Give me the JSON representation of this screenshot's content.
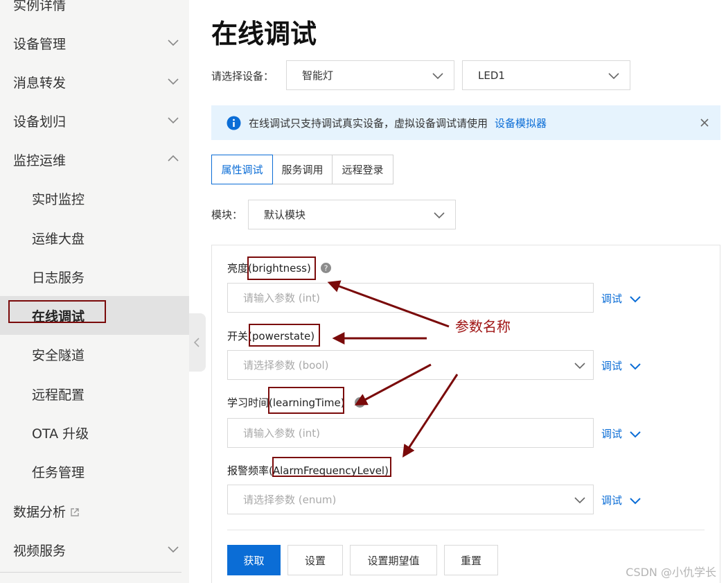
{
  "sidebar": {
    "items": [
      {
        "label": "实例详情"
      },
      {
        "label": "设备管理"
      },
      {
        "label": "消息转发"
      },
      {
        "label": "设备划归"
      },
      {
        "label": "监控运维"
      },
      {
        "label": "实时监控"
      },
      {
        "label": "运维大盘"
      },
      {
        "label": "日志服务"
      },
      {
        "label": "在线调试"
      },
      {
        "label": "安全隧道"
      },
      {
        "label": "远程配置"
      },
      {
        "label": "OTA 升级"
      },
      {
        "label": "任务管理"
      },
      {
        "label": "数据分析"
      },
      {
        "label": "视频服务"
      }
    ]
  },
  "page": {
    "title": "在线调试",
    "device_label": "请选择设备：",
    "product_select": "智能灯",
    "device_select": "LED1",
    "notice_text": "在线调试只支持调试真实设备，虚拟设备调试请使用",
    "notice_link": "设备模拟器",
    "tabs": [
      {
        "label": "属性调试",
        "active": true
      },
      {
        "label": "服务调用",
        "active": false
      },
      {
        "label": "远程登录",
        "active": false
      }
    ],
    "module_label": "模块：",
    "module_select": "默认模块"
  },
  "properties": [
    {
      "name_cn": "亮度",
      "name_id": "(brightness)",
      "placeholder": "请输入参数 (int)",
      "debug": "调试"
    },
    {
      "name_cn": "开关",
      "name_id": "(powerstate)",
      "placeholder": "请选择参数 (bool)",
      "debug": "调试"
    },
    {
      "name_cn": "学习时间",
      "name_id": "(learningTime)",
      "placeholder": "请输入参数 (int)",
      "debug": "调试"
    },
    {
      "name_cn": "报警频率",
      "name_id": "(AlarmFrequencyLevel)",
      "placeholder": "请选择参数 (enum)",
      "debug": "调试"
    }
  ],
  "actions": {
    "get": "获取",
    "set": "设置",
    "set_expected": "设置期望值",
    "reset": "重置"
  },
  "annotation": {
    "text": "参数名称"
  },
  "watermark": "CSDN @小仇学长",
  "colors": {
    "accent": "#0b6dd6",
    "annotation": "#7a0a0a",
    "notice_bg": "#e6f3fd"
  }
}
